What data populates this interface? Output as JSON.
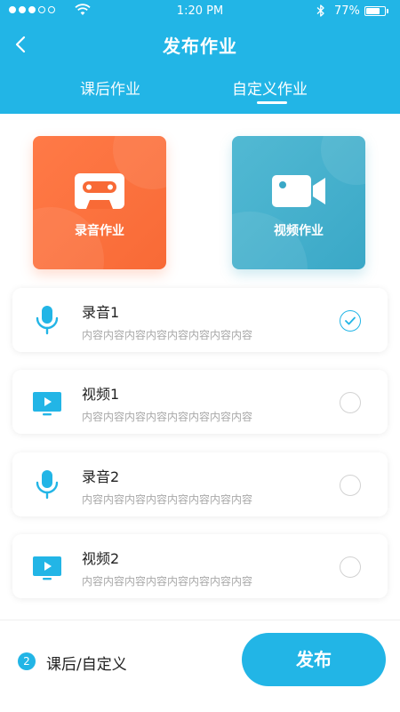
{
  "status_bar": {
    "time": "1:20 PM",
    "battery": "77%",
    "battery_level_percent": 77
  },
  "nav": {
    "title": "发布作业",
    "back_icon": "chevron-left-icon"
  },
  "tabs": [
    {
      "label": "课后作业",
      "active": false
    },
    {
      "label": "自定义作业",
      "active": true
    }
  ],
  "cards": [
    {
      "label": "录音作业",
      "icon": "cassette-tape-icon",
      "color": "#f86a36"
    },
    {
      "label": "视频作业",
      "icon": "video-camera-icon",
      "color": "#3aa8c7"
    }
  ],
  "items": [
    {
      "title": "录音1",
      "subtitle": "内容内容内容内容内容内容内容内容",
      "icon": "microphone-icon",
      "checked": true
    },
    {
      "title": "视频1",
      "subtitle": "内容内容内容内容内容内容内容内容",
      "icon": "video-play-icon",
      "checked": false
    },
    {
      "title": "录音2",
      "subtitle": "内容内容内容内容内容内容内容内容",
      "icon": "microphone-icon",
      "checked": false
    },
    {
      "title": "视频2",
      "subtitle": "内容内容内容内容内容内容内容内容",
      "icon": "video-play-icon",
      "checked": false
    }
  ],
  "footer": {
    "count": "2",
    "selected_label": "课后/自定义",
    "publish_label": "发布"
  },
  "colors": {
    "primary": "#22b5e6",
    "audio_card": "#f86a36",
    "video_card": "#3aa8c7"
  }
}
